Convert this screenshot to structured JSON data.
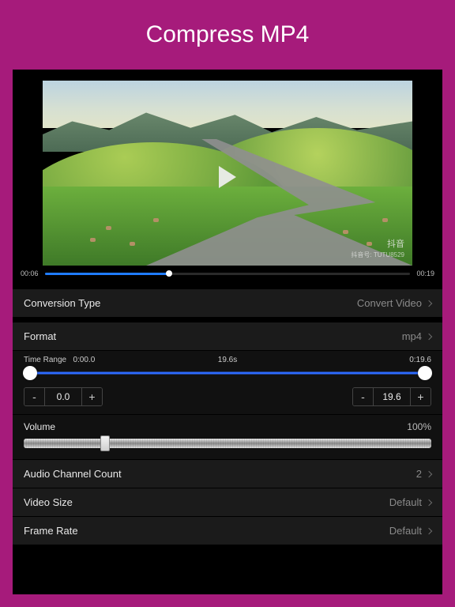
{
  "header": {
    "title": "Compress MP4"
  },
  "video": {
    "current_time": "00:06",
    "duration": "00:19",
    "progress_pct": 34,
    "watermark1": "抖音",
    "watermark2": "抖音号: TUTU8529"
  },
  "rows": {
    "conversion_type": {
      "label": "Conversion Type",
      "value": "Convert Video"
    },
    "format": {
      "label": "Format",
      "value": "mp4"
    },
    "audio_channels": {
      "label": "Audio Channel Count",
      "value": "2"
    },
    "video_size": {
      "label": "Video Size",
      "value": "Default"
    },
    "frame_rate": {
      "label": "Frame Rate",
      "value": "Default"
    }
  },
  "time_range": {
    "label": "Time Range",
    "start_display": "0:00.0",
    "mid_display": "19.6s",
    "end_display": "0:19.6",
    "stepper_start": "0.0",
    "stepper_end": "19.6"
  },
  "volume": {
    "label": "Volume",
    "pct_display": "100%",
    "thumb_pct": 20
  }
}
